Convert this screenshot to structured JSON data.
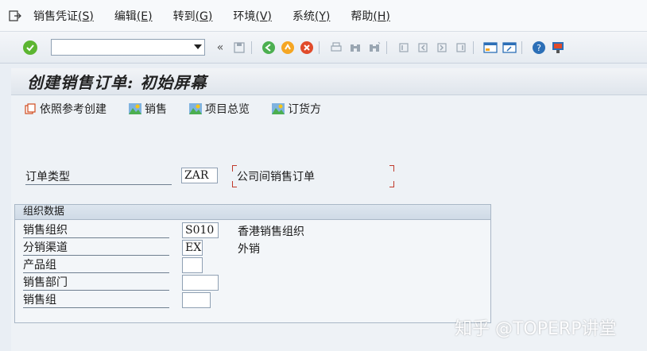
{
  "menubar": {
    "items": [
      {
        "label": "销售凭证",
        "key": "(S)"
      },
      {
        "label": "编辑",
        "key": "(E)"
      },
      {
        "label": "转到",
        "key": "(G)"
      },
      {
        "label": "环境",
        "key": "(V)"
      },
      {
        "label": "系统",
        "key": "(Y)"
      },
      {
        "label": "帮助",
        "key": "(H)"
      }
    ]
  },
  "toolbar": {
    "command_value": "",
    "back_glyph": "«"
  },
  "title": "创建销售订单: 初始屏幕",
  "app_toolbar": {
    "create_ref": "依照参考创建",
    "sales": "销售",
    "item_overview": "项目总览",
    "sold_to": "订货方"
  },
  "order_type": {
    "label": "订单类型",
    "value": "ZAR",
    "description": "公司间销售订单"
  },
  "org_data": {
    "header": "组织数据",
    "rows": [
      {
        "label": "销售组织",
        "value": "S010",
        "description": "香港销售组织"
      },
      {
        "label": "分销渠道",
        "value": "EX",
        "description": "外销"
      },
      {
        "label": "产品组",
        "value": "",
        "description": ""
      },
      {
        "label": "销售部门",
        "value": "",
        "description": ""
      },
      {
        "label": "销售组",
        "value": "",
        "description": ""
      }
    ]
  },
  "watermark": "知乎 @TOPERP讲堂",
  "colors": {
    "accent_green": "#5cb531",
    "bracket_red": "#c0392b",
    "background": "#e9eef4"
  }
}
